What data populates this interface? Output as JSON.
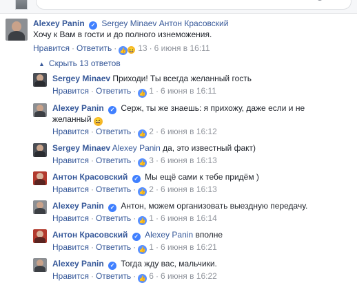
{
  "main_comment": {
    "author": "Alexey Panin",
    "tags": "Sergey Minaev Антон Красовский",
    "text": "Хочу к Вам в гости и до полного изнеможения.",
    "like_label": "Нравится",
    "reply_label": "Ответить",
    "reaction_count": "13",
    "timestamp": "6 июня в 16:11"
  },
  "replies_toggle": {
    "label": "Скрыть 13 ответов"
  },
  "replies": [
    {
      "author": "Sergey Minaev",
      "verified": false,
      "tag": "",
      "text": "Приходи! Ты всегда желанный гость",
      "text2": "",
      "like_label": "Нравится",
      "reply_label": "Ответить",
      "reaction_count": "1",
      "timestamp": "6 июня в 16:11"
    },
    {
      "author": "Alexey Panin",
      "verified": true,
      "tag": "",
      "text": "Серж, ты же знаешь: я прихожу, даже если и не",
      "text2": "желанный",
      "like_label": "Нравится",
      "reply_label": "Ответить",
      "reaction_count": "2",
      "timestamp": "6 июня в 16:12"
    },
    {
      "author": "Sergey Minaev",
      "verified": false,
      "tag": "Alexey Panin",
      "text": "да, это известный факт)",
      "text2": "",
      "like_label": "Нравится",
      "reply_label": "Ответить",
      "reaction_count": "3",
      "timestamp": "6 июня в 16:13"
    },
    {
      "author": "Антон Красовский",
      "verified": true,
      "tag": "",
      "text": "Мы ещё сами к тебе придём )",
      "text2": "",
      "like_label": "Нравится",
      "reply_label": "Ответить",
      "reaction_count": "2",
      "timestamp": "6 июня в 16:13"
    },
    {
      "author": "Alexey Panin",
      "verified": true,
      "tag": "",
      "text": "Антон, можем организовать выездную передачу.",
      "text2": "",
      "like_label": "Нравится",
      "reply_label": "Ответить",
      "reaction_count": "1",
      "timestamp": "6 июня в 16:14"
    },
    {
      "author": "Антон Красовский",
      "verified": true,
      "tag": "Alexey Panin",
      "text": "вполне",
      "text2": "",
      "like_label": "Нравится",
      "reply_label": "Ответить",
      "reaction_count": "1",
      "timestamp": "6 июня в 16:21"
    },
    {
      "author": "Alexey Panin",
      "verified": true,
      "tag": "",
      "text": "Тогда жду вас, мальчики.",
      "text2": "",
      "like_label": "Нравится",
      "reply_label": "Ответить",
      "reaction_count": "6",
      "timestamp": "6 июня в 16:22"
    }
  ],
  "colors": {
    "link": "#365899",
    "meta": "#90949c",
    "like": "#5890ff",
    "verified": "#4080ff"
  },
  "icons": {
    "like": "thumbs-up-icon",
    "haha": "haha-face-icon",
    "verified": "verified-badge-icon",
    "toggle": "caret-up-icon"
  }
}
